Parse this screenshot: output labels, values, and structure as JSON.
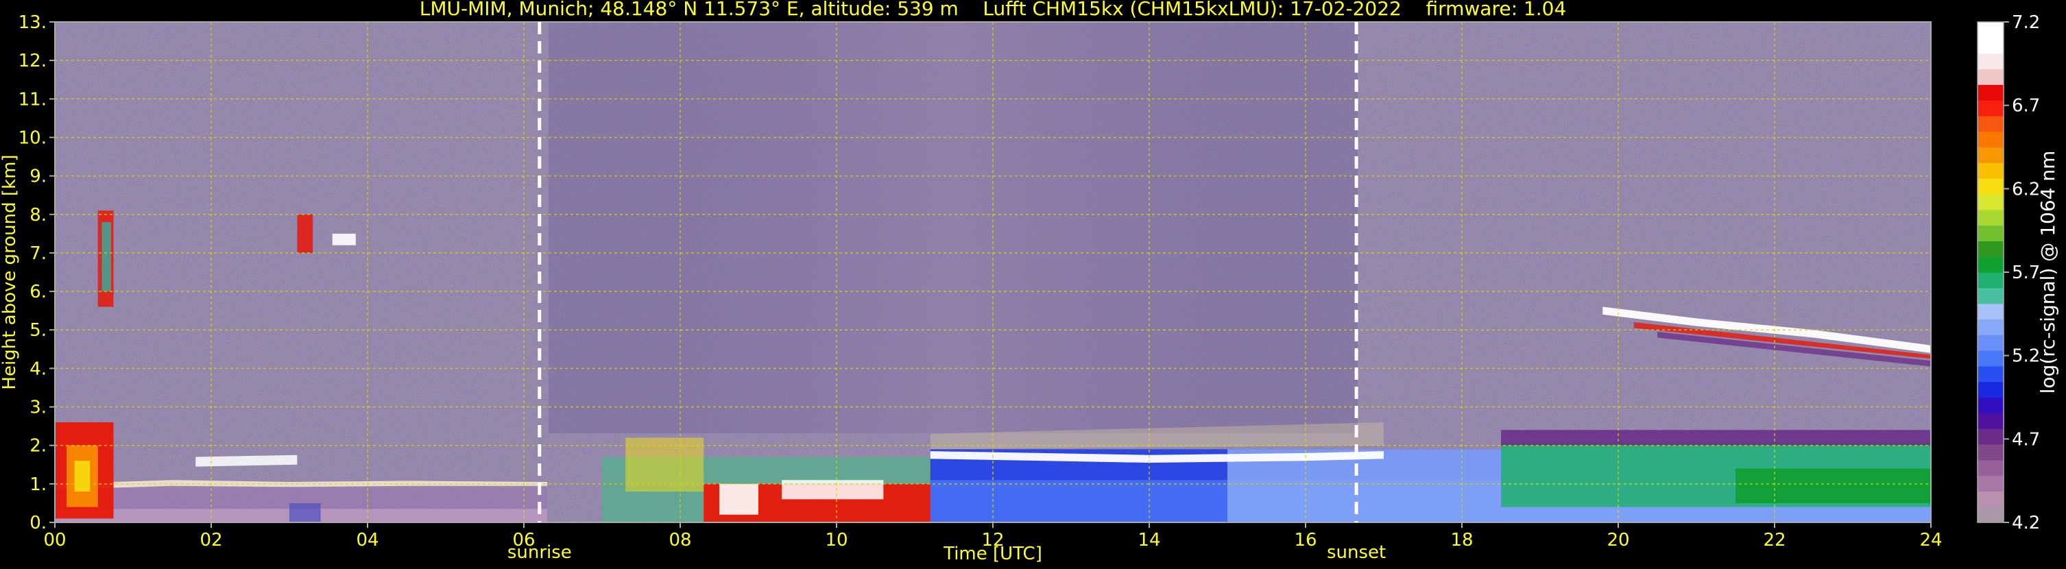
{
  "chart_data": {
    "type": "heatmap",
    "title": "LMU-MIM, Munich; 48.148° N 11.573° E, altitude: 539 m    Lufft CHM15kx (CHM15kxLMU): 17-02-2022    firmware: 1.04",
    "xlabel": "Time [UTC]",
    "ylabel": "Height above ground [km]",
    "xlim": [
      0,
      24
    ],
    "ylim": [
      0,
      13
    ],
    "x_ticks": [
      "00",
      "02",
      "04",
      "06",
      "08",
      "10",
      "12",
      "14",
      "16",
      "18",
      "20",
      "22",
      "24"
    ],
    "y_ticks": [
      "0.",
      "1.",
      "2.",
      "3.",
      "4.",
      "5.",
      "6.",
      "7.",
      "8.",
      "9.",
      "10.",
      "11.",
      "12.",
      "13."
    ],
    "grid": true,
    "colorbar": {
      "label": "log(rc-signal) @ 1064 nm",
      "range": [
        4.2,
        7.2
      ],
      "ticks": [
        "4.2",
        "4.7",
        "5.2",
        "5.7",
        "6.2",
        "6.7",
        "7.2"
      ],
      "colors": [
        "#a898a8",
        "#b890b0",
        "#a878a8",
        "#986098",
        "#804888",
        "#6a2c88",
        "#5010a0",
        "#3010c0",
        "#1828e0",
        "#2850f0",
        "#4878f8",
        "#6890f8",
        "#88a8f8",
        "#a8c0f8",
        "#48c0a0",
        "#20b070",
        "#10a030",
        "#309820",
        "#70c030",
        "#a8d830",
        "#d8e830",
        "#f8e010",
        "#f8c000",
        "#f89800",
        "#f87800",
        "#f85810",
        "#f82010",
        "#e80808",
        "#f0c8c8",
        "#f8e8e8",
        "#ffffff",
        "#ffffff"
      ]
    },
    "markers": [
      {
        "label": "sunrise",
        "x": 6.2
      },
      {
        "label": "sunset",
        "x": 16.65
      }
    ]
  }
}
